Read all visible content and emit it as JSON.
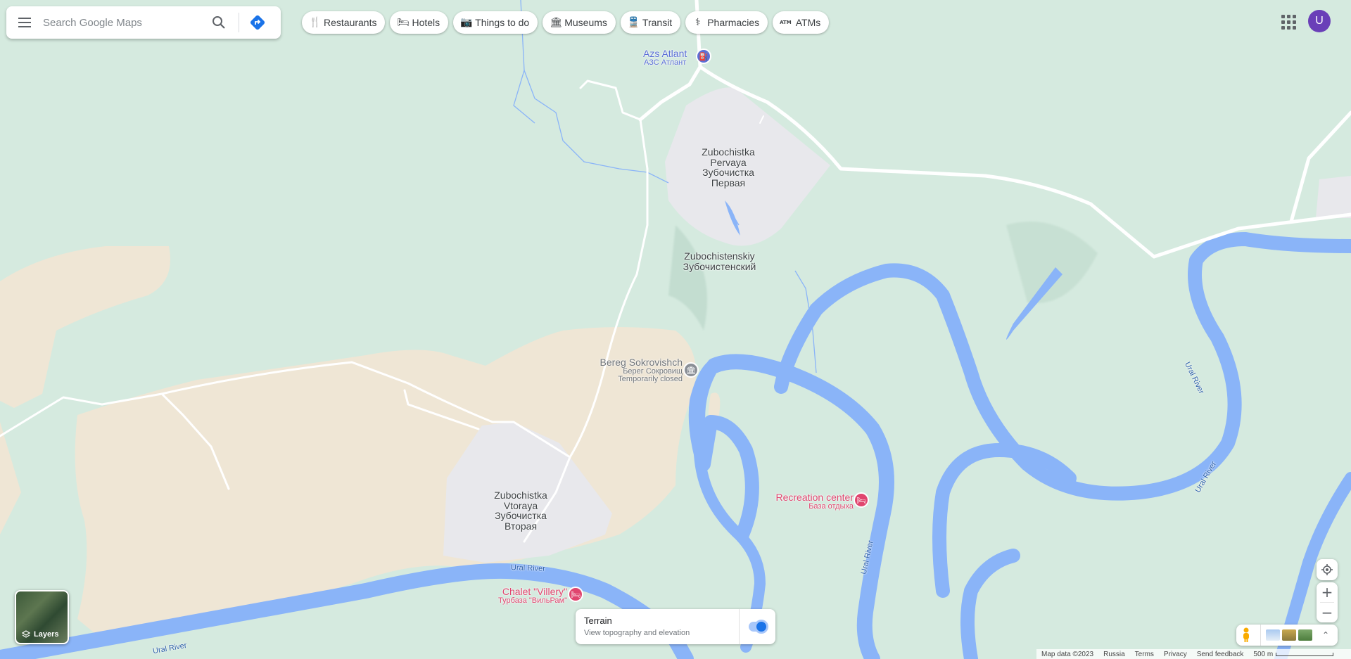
{
  "search": {
    "placeholder": "Search Google Maps"
  },
  "chips": [
    {
      "label": "Restaurants",
      "icon": "restaurant-icon",
      "glyph": "🍴"
    },
    {
      "label": "Hotels",
      "icon": "hotel-icon",
      "glyph": "🛏"
    },
    {
      "label": "Things to do",
      "icon": "camera-icon",
      "glyph": "📷"
    },
    {
      "label": "Museums",
      "icon": "museum-icon",
      "glyph": "🏛"
    },
    {
      "label": "Transit",
      "icon": "transit-icon",
      "glyph": "🚆"
    },
    {
      "label": "Pharmacies",
      "icon": "pharmacy-icon",
      "glyph": "⚕"
    },
    {
      "label": "ATMs",
      "icon": "atm-icon",
      "glyph": "ATM"
    }
  ],
  "account": {
    "initial": "U"
  },
  "places": {
    "azs_name": "Azs Atlant",
    "azs_sub": "АЗС Атлант",
    "zp1": "Zubochistka",
    "zp2": "Pervaya",
    "zp3": "Зубочистка",
    "zp4": "Первая",
    "zs1": "Zubochistenskiy",
    "zs2": "Зубочистенский",
    "bereg1": "Bereg Sokrovishch",
    "bereg2": "Берег Сокровищ",
    "bereg3": "Temporarily closed",
    "zv1": "Zubochistka",
    "zv2": "Vtoraya",
    "zv3": "Зубочистка",
    "zv4": "Вторая",
    "rec1": "Recreation center",
    "rec2": "База отдыха",
    "chalet1": "Chalet \"Villery\"",
    "chalet2": "Турбаза \"ВильРам\"",
    "river": "Ural River"
  },
  "layers": {
    "label": "Layers"
  },
  "terrain": {
    "title": "Terrain",
    "desc": "View topography and elevation",
    "enabled": true
  },
  "footer": {
    "data": "Map data ©2023",
    "region": "Russia",
    "terms": "Terms",
    "privacy": "Privacy",
    "feedback": "Send feedback",
    "scale": "500 m"
  },
  "colors": {
    "land": "#d5eadf",
    "sand": "#efe6d5",
    "urban": "#e8e8ec",
    "water": "#8ab4f8",
    "road": "#ffffff",
    "poi_blue": "#5b6fd6",
    "poi_pink": "#e0456e",
    "poi_gray": "#8a8f96"
  }
}
